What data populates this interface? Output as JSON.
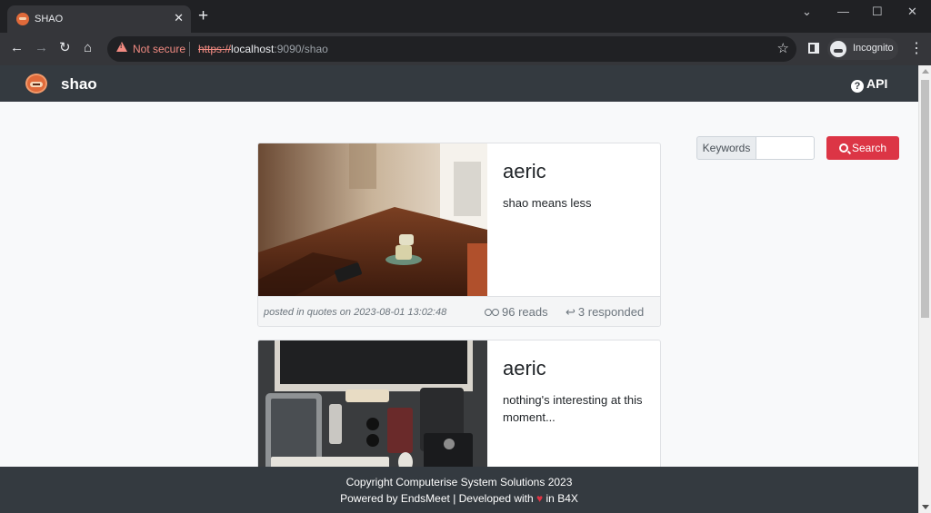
{
  "browser": {
    "tab_title": "SHAO",
    "tab_close": "✕",
    "new_tab": "+",
    "window_controls": [
      "⌄",
      "—",
      "☐",
      "✕"
    ],
    "security_label": "Not secure",
    "url_scheme": "https://",
    "url_host": "localhost",
    "url_rest": ":9090/shao",
    "incognito_label": "Incognito",
    "icons": [
      "back-arrow-icon",
      "forward-arrow-icon",
      "reload-icon",
      "home-icon",
      "warning-icon",
      "star-icon",
      "side-panel-icon",
      "incognito-icon",
      "menu-icon"
    ]
  },
  "navbar": {
    "brand": "shao",
    "api_label": "API"
  },
  "search": {
    "label": "Keywords",
    "value": "",
    "button_label": "Search"
  },
  "posts": [
    {
      "author": "aeric",
      "excerpt": "shao means less",
      "meta": "posted in quotes on 2023-08-01 13:02:48",
      "reads": "96 reads",
      "responded": "3 responded"
    },
    {
      "author": "aeric",
      "excerpt": "nothing's interesting at this moment..."
    }
  ],
  "footer": {
    "copyright": "Copyright Computerise System Solutions 2023",
    "powered_prefix": "Powered by EndsMeet | Developed with",
    "heart": "♥",
    "powered_suffix": "in B4X"
  },
  "colors": {
    "navbar": "#343a40",
    "search_button": "#dc3545",
    "browser_tabbar": "#202124",
    "browser_toolbar": "#35363a"
  }
}
